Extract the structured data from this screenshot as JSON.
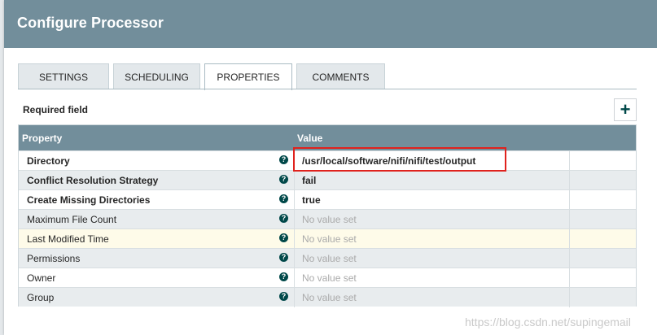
{
  "dialog": {
    "title": "Configure Processor"
  },
  "tabs": [
    {
      "label": "SETTINGS",
      "active": false
    },
    {
      "label": "SCHEDULING",
      "active": false
    },
    {
      "label": "PROPERTIES",
      "active": true
    },
    {
      "label": "COMMENTS",
      "active": false
    }
  ],
  "required_field_label": "Required field",
  "add_property_icon": "plus-icon",
  "grid": {
    "columns": [
      "Property",
      "Value"
    ],
    "rows": [
      {
        "name": "Directory",
        "required": true,
        "value": "/usr/local/software/nifi/nifi/test/output",
        "has_value": true,
        "style": "white"
      },
      {
        "name": "Conflict Resolution Strategy",
        "required": true,
        "value": "fail",
        "has_value": true,
        "style": "grey"
      },
      {
        "name": "Create Missing Directories",
        "required": true,
        "value": "true",
        "has_value": true,
        "style": "white"
      },
      {
        "name": "Maximum File Count",
        "required": false,
        "value": "No value set",
        "has_value": false,
        "style": "grey"
      },
      {
        "name": "Last Modified Time",
        "required": false,
        "value": "No value set",
        "has_value": false,
        "style": "highlight"
      },
      {
        "name": "Permissions",
        "required": false,
        "value": "No value set",
        "has_value": false,
        "style": "grey"
      },
      {
        "name": "Owner",
        "required": false,
        "value": "No value set",
        "has_value": false,
        "style": "white"
      },
      {
        "name": "Group",
        "required": false,
        "value": "No value set",
        "has_value": false,
        "style": "grey"
      }
    ]
  },
  "help_icon": "question-circle-icon",
  "help_glyph": "?",
  "add_glyph": "+",
  "watermark": "https://blog.csdn.net/supingemail",
  "colors": {
    "header": "#728e9b",
    "accent": "#004849",
    "annotation_box": "#e0221d"
  }
}
